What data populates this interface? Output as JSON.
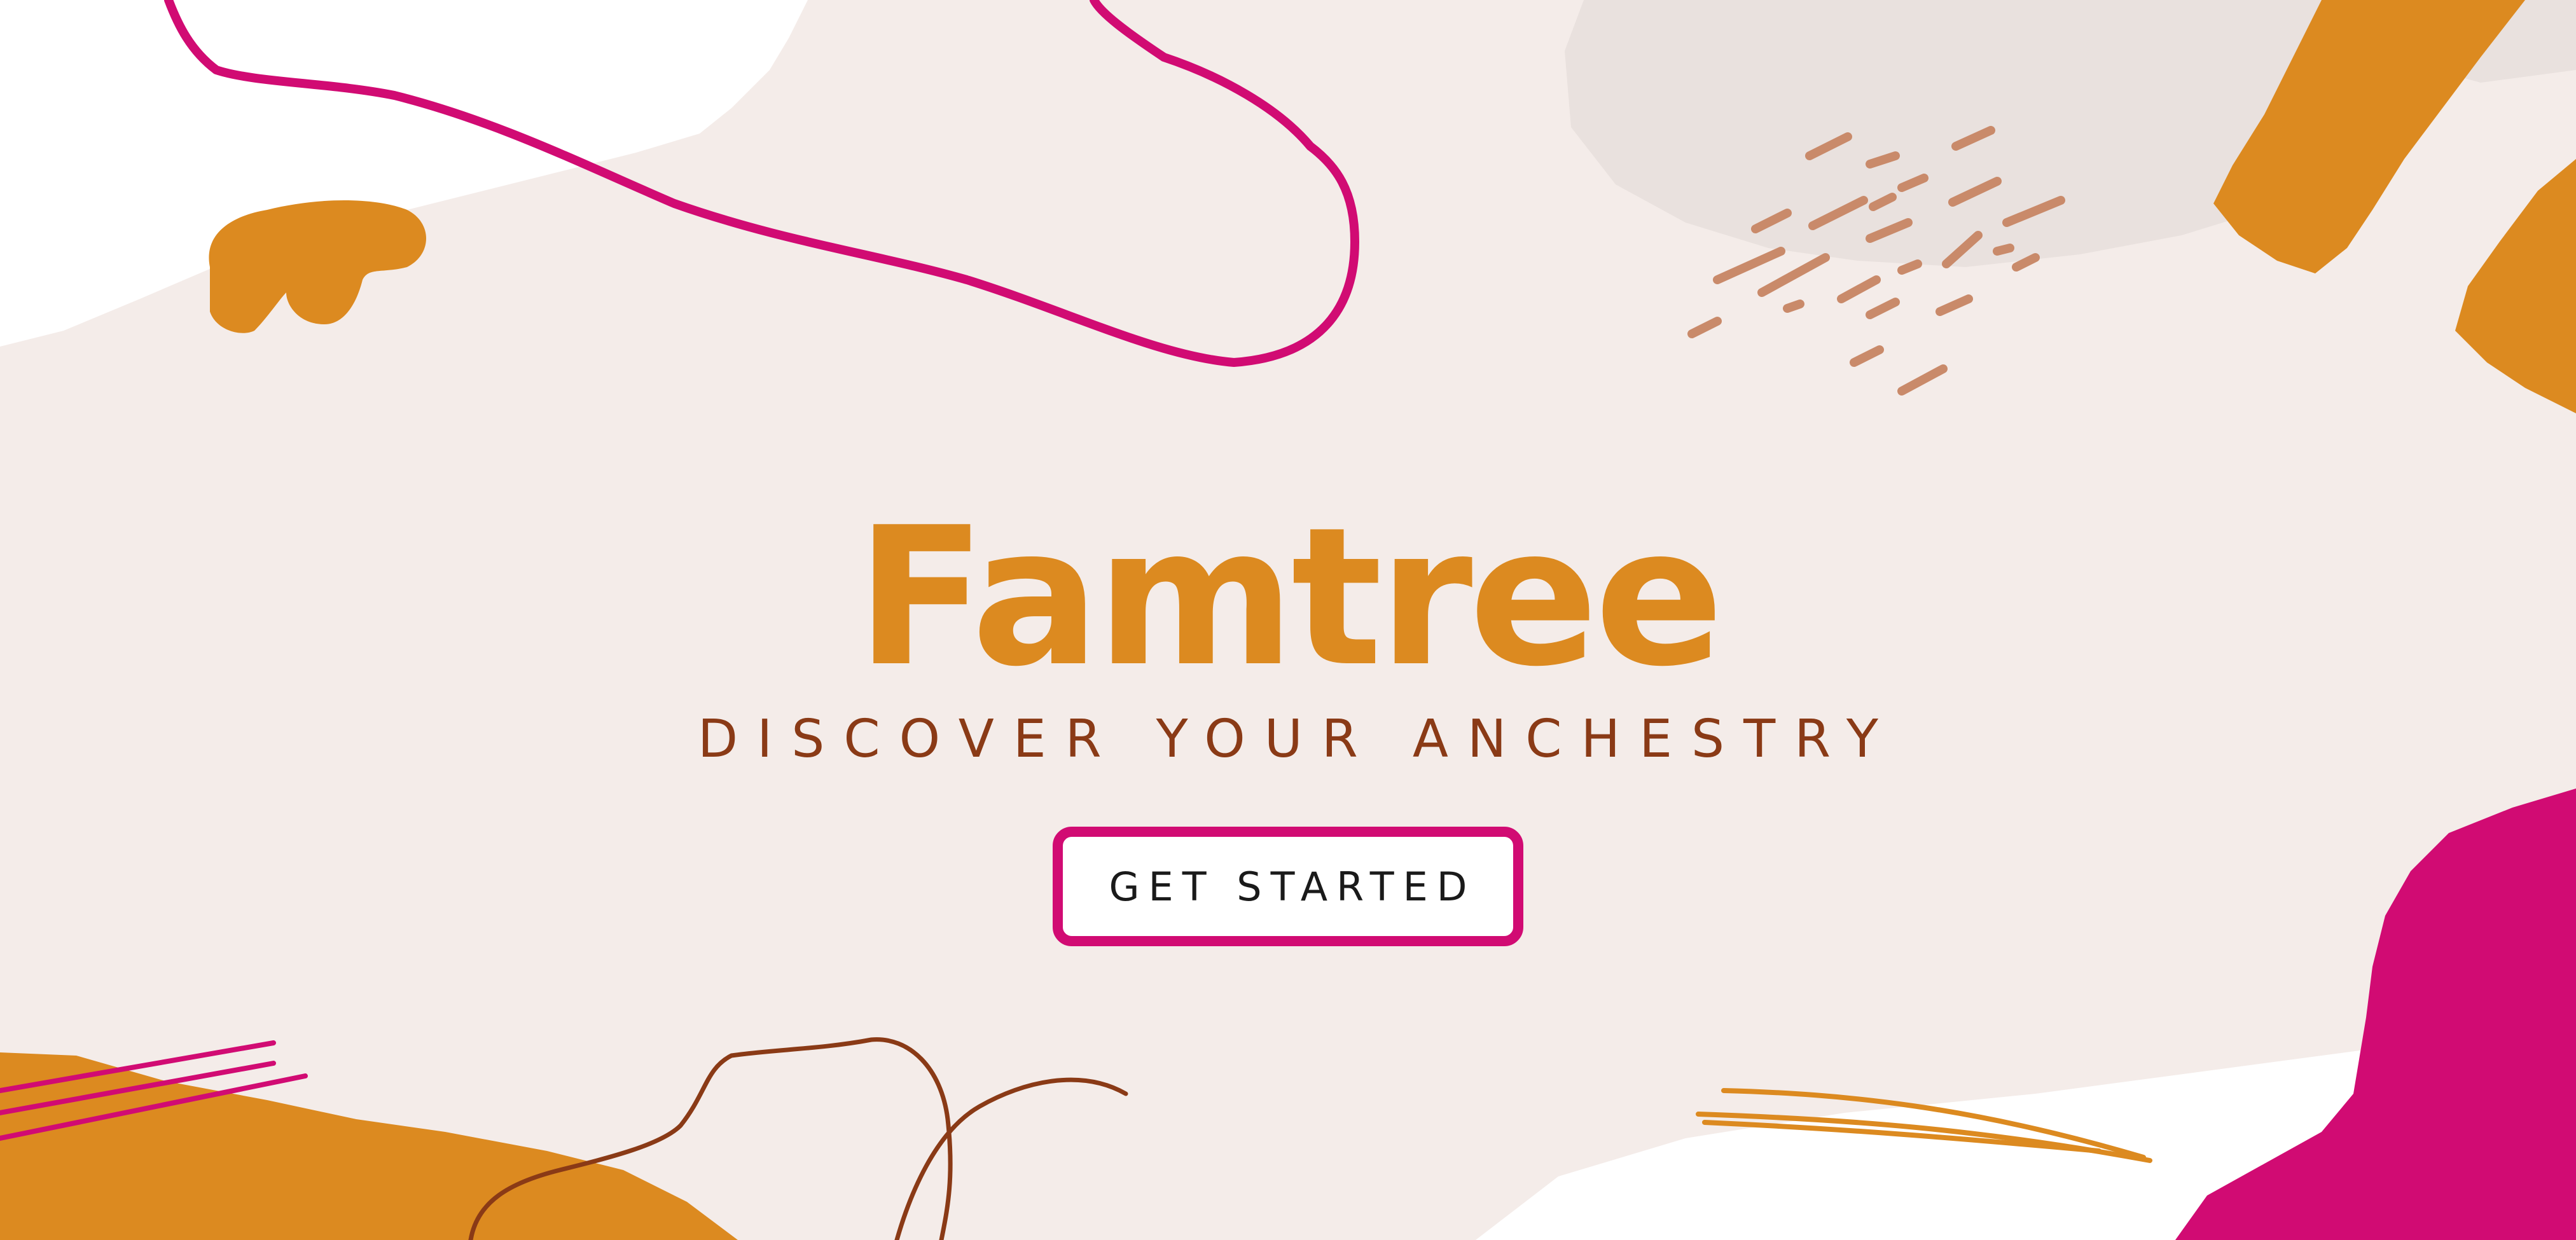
{
  "hero": {
    "title": "Famtree",
    "tagline": "DISCOVER YOUR ANCHESTRY",
    "cta_label": "GET STARTED"
  },
  "colors": {
    "background": "#f4ece9",
    "orange_accent": "#dc8a20",
    "magenta_accent": "#d10b73",
    "brown_text": "#8a3a16",
    "tan_strokes": "#c98a6a",
    "button_background": "#ffffff"
  }
}
